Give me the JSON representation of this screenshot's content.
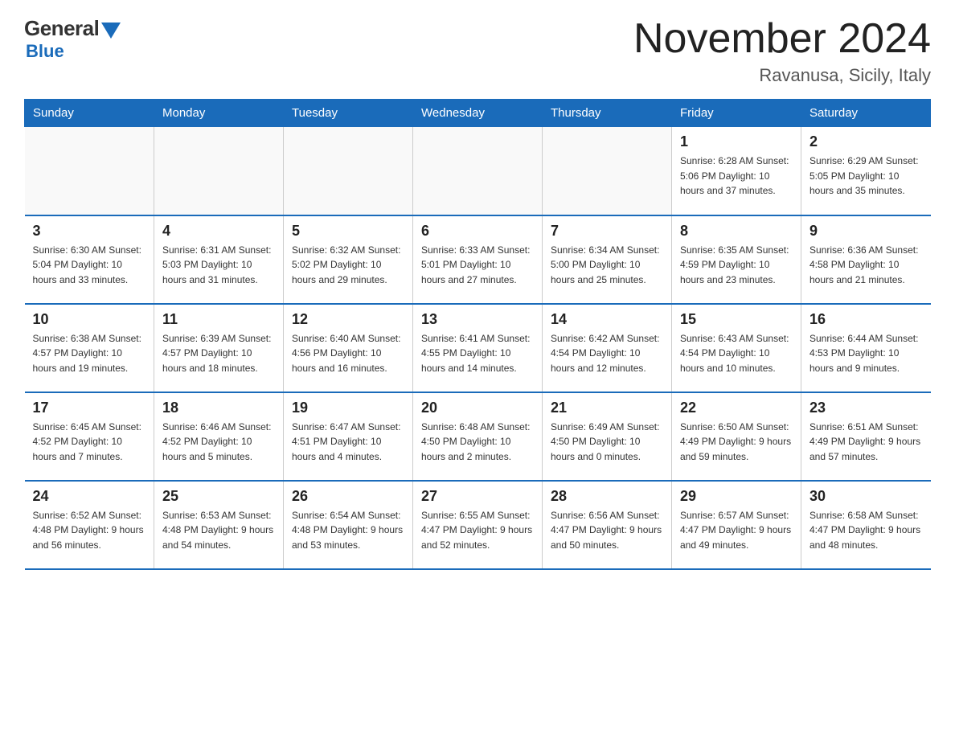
{
  "logo": {
    "general": "General",
    "blue": "Blue"
  },
  "title": "November 2024",
  "location": "Ravanusa, Sicily, Italy",
  "days_of_week": [
    "Sunday",
    "Monday",
    "Tuesday",
    "Wednesday",
    "Thursday",
    "Friday",
    "Saturday"
  ],
  "weeks": [
    [
      {
        "day": "",
        "info": ""
      },
      {
        "day": "",
        "info": ""
      },
      {
        "day": "",
        "info": ""
      },
      {
        "day": "",
        "info": ""
      },
      {
        "day": "",
        "info": ""
      },
      {
        "day": "1",
        "info": "Sunrise: 6:28 AM\nSunset: 5:06 PM\nDaylight: 10 hours and 37 minutes."
      },
      {
        "day": "2",
        "info": "Sunrise: 6:29 AM\nSunset: 5:05 PM\nDaylight: 10 hours and 35 minutes."
      }
    ],
    [
      {
        "day": "3",
        "info": "Sunrise: 6:30 AM\nSunset: 5:04 PM\nDaylight: 10 hours and 33 minutes."
      },
      {
        "day": "4",
        "info": "Sunrise: 6:31 AM\nSunset: 5:03 PM\nDaylight: 10 hours and 31 minutes."
      },
      {
        "day": "5",
        "info": "Sunrise: 6:32 AM\nSunset: 5:02 PM\nDaylight: 10 hours and 29 minutes."
      },
      {
        "day": "6",
        "info": "Sunrise: 6:33 AM\nSunset: 5:01 PM\nDaylight: 10 hours and 27 minutes."
      },
      {
        "day": "7",
        "info": "Sunrise: 6:34 AM\nSunset: 5:00 PM\nDaylight: 10 hours and 25 minutes."
      },
      {
        "day": "8",
        "info": "Sunrise: 6:35 AM\nSunset: 4:59 PM\nDaylight: 10 hours and 23 minutes."
      },
      {
        "day": "9",
        "info": "Sunrise: 6:36 AM\nSunset: 4:58 PM\nDaylight: 10 hours and 21 minutes."
      }
    ],
    [
      {
        "day": "10",
        "info": "Sunrise: 6:38 AM\nSunset: 4:57 PM\nDaylight: 10 hours and 19 minutes."
      },
      {
        "day": "11",
        "info": "Sunrise: 6:39 AM\nSunset: 4:57 PM\nDaylight: 10 hours and 18 minutes."
      },
      {
        "day": "12",
        "info": "Sunrise: 6:40 AM\nSunset: 4:56 PM\nDaylight: 10 hours and 16 minutes."
      },
      {
        "day": "13",
        "info": "Sunrise: 6:41 AM\nSunset: 4:55 PM\nDaylight: 10 hours and 14 minutes."
      },
      {
        "day": "14",
        "info": "Sunrise: 6:42 AM\nSunset: 4:54 PM\nDaylight: 10 hours and 12 minutes."
      },
      {
        "day": "15",
        "info": "Sunrise: 6:43 AM\nSunset: 4:54 PM\nDaylight: 10 hours and 10 minutes."
      },
      {
        "day": "16",
        "info": "Sunrise: 6:44 AM\nSunset: 4:53 PM\nDaylight: 10 hours and 9 minutes."
      }
    ],
    [
      {
        "day": "17",
        "info": "Sunrise: 6:45 AM\nSunset: 4:52 PM\nDaylight: 10 hours and 7 minutes."
      },
      {
        "day": "18",
        "info": "Sunrise: 6:46 AM\nSunset: 4:52 PM\nDaylight: 10 hours and 5 minutes."
      },
      {
        "day": "19",
        "info": "Sunrise: 6:47 AM\nSunset: 4:51 PM\nDaylight: 10 hours and 4 minutes."
      },
      {
        "day": "20",
        "info": "Sunrise: 6:48 AM\nSunset: 4:50 PM\nDaylight: 10 hours and 2 minutes."
      },
      {
        "day": "21",
        "info": "Sunrise: 6:49 AM\nSunset: 4:50 PM\nDaylight: 10 hours and 0 minutes."
      },
      {
        "day": "22",
        "info": "Sunrise: 6:50 AM\nSunset: 4:49 PM\nDaylight: 9 hours and 59 minutes."
      },
      {
        "day": "23",
        "info": "Sunrise: 6:51 AM\nSunset: 4:49 PM\nDaylight: 9 hours and 57 minutes."
      }
    ],
    [
      {
        "day": "24",
        "info": "Sunrise: 6:52 AM\nSunset: 4:48 PM\nDaylight: 9 hours and 56 minutes."
      },
      {
        "day": "25",
        "info": "Sunrise: 6:53 AM\nSunset: 4:48 PM\nDaylight: 9 hours and 54 minutes."
      },
      {
        "day": "26",
        "info": "Sunrise: 6:54 AM\nSunset: 4:48 PM\nDaylight: 9 hours and 53 minutes."
      },
      {
        "day": "27",
        "info": "Sunrise: 6:55 AM\nSunset: 4:47 PM\nDaylight: 9 hours and 52 minutes."
      },
      {
        "day": "28",
        "info": "Sunrise: 6:56 AM\nSunset: 4:47 PM\nDaylight: 9 hours and 50 minutes."
      },
      {
        "day": "29",
        "info": "Sunrise: 6:57 AM\nSunset: 4:47 PM\nDaylight: 9 hours and 49 minutes."
      },
      {
        "day": "30",
        "info": "Sunrise: 6:58 AM\nSunset: 4:47 PM\nDaylight: 9 hours and 48 minutes."
      }
    ]
  ]
}
